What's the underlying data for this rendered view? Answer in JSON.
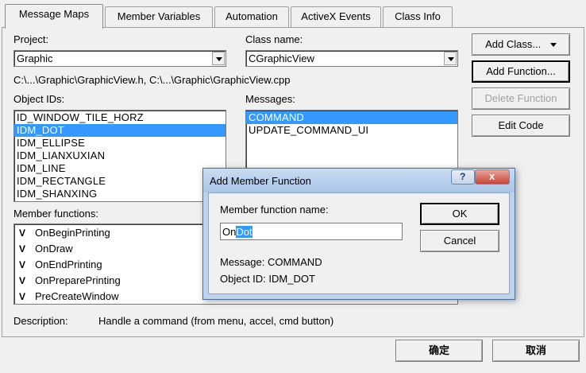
{
  "tabs": [
    {
      "label": "Message Maps",
      "active": true
    },
    {
      "label": "Member Variables",
      "active": false
    },
    {
      "label": "Automation",
      "active": false
    },
    {
      "label": "ActiveX Events",
      "active": false
    },
    {
      "label": "Class Info",
      "active": false
    }
  ],
  "project": {
    "label": "Project:",
    "value": "Graphic"
  },
  "class_name": {
    "label": "Class name:",
    "value": "CGraphicView"
  },
  "file_path": "C:\\...\\Graphic\\GraphicView.h, C:\\...\\Graphic\\GraphicView.cpp",
  "object_ids": {
    "label": "Object IDs:",
    "items": [
      "ID_WINDOW_TILE_HORZ",
      "IDM_DOT",
      "IDM_ELLIPSE",
      "IDM_LIANXUXIAN",
      "IDM_LINE",
      "IDM_RECTANGLE",
      "IDM_SHANXING"
    ],
    "selected": "IDM_DOT"
  },
  "messages": {
    "label": "Messages:",
    "items": [
      "COMMAND",
      "UPDATE_COMMAND_UI"
    ],
    "selected": "COMMAND"
  },
  "member_functions": {
    "label": "Member functions:",
    "items": [
      {
        "flag": "V",
        "name": "OnBeginPrinting"
      },
      {
        "flag": "V",
        "name": "OnDraw"
      },
      {
        "flag": "V",
        "name": "OnEndPrinting"
      },
      {
        "flag": "V",
        "name": "OnPreparePrinting"
      },
      {
        "flag": "V",
        "name": "PreCreateWindow"
      }
    ]
  },
  "buttons": {
    "add_class": "Add Class...",
    "add_function": "Add Function...",
    "delete_function": "Delete Function",
    "edit_code": "Edit Code",
    "ok": "确定",
    "cancel": "取消"
  },
  "description": {
    "label": "Description:",
    "value": "Handle a command (from menu, accel, cmd button)"
  },
  "dialog": {
    "title": "Add Member Function",
    "help_glyph": "?",
    "close_glyph": "x",
    "name_label": "Member function name:",
    "name_prefix": "On",
    "name_selected": "Dot",
    "message_text": "Message: COMMAND",
    "object_id_text": "Object ID: IDM_DOT",
    "ok": "OK",
    "cancel": "Cancel"
  }
}
